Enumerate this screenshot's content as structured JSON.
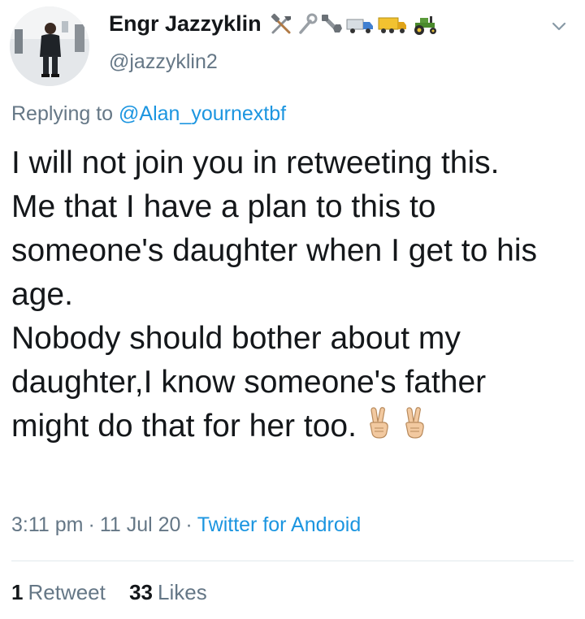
{
  "user": {
    "display_name": "Engr Jazzyklin",
    "handle": "@jazzyklin2",
    "name_emojis": [
      "hammer-and-wrench",
      "wrench",
      "nut-and-bolt",
      "delivery-truck",
      "articulated-lorry",
      "tractor"
    ]
  },
  "reply": {
    "prefix": "Replying to ",
    "to_handle": "@Alan_yournextbf"
  },
  "tweet": {
    "lines": [
      "I will not join you in retweeting this.",
      "Me that I have a plan to this to someone's daughter when I get to his age.",
      "Nobody should bother about my daughter,I know someone's father might do that for her too."
    ],
    "trailing_emojis": [
      "victory-hand",
      "victory-hand"
    ]
  },
  "meta": {
    "time": "3:11 pm",
    "date": "11 Jul 20",
    "separator": "·",
    "source": "Twitter for Android"
  },
  "stats": {
    "retweets_count": "1",
    "retweets_label": "Retweet",
    "likes_count": "33",
    "likes_label": "Likes"
  },
  "colors": {
    "link": "#1b95e0",
    "secondary_text": "#657786",
    "primary_text": "#14171a",
    "divider": "#e1e8ed"
  }
}
